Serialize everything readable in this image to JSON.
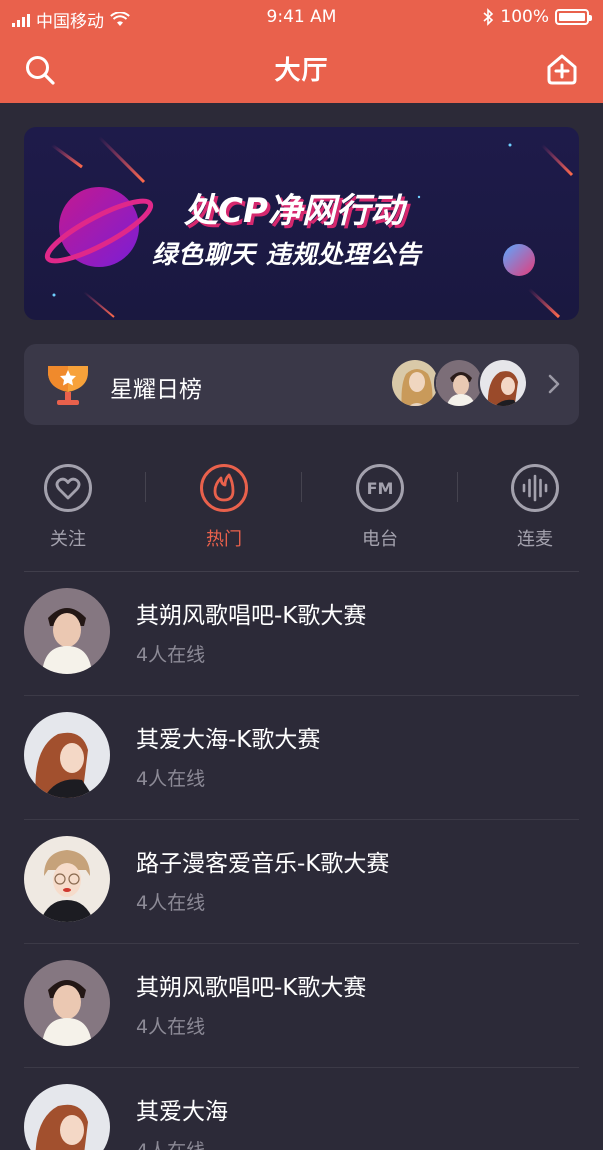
{
  "status_bar": {
    "carrier": "中国移动",
    "time": "9:41 AM",
    "battery": "100%"
  },
  "nav": {
    "title": "大厅",
    "left_icon": "search-icon",
    "right_icon": "add-room-icon"
  },
  "banner": {
    "title": "处CP净网行动",
    "subtitle": "绿色聊天 违规处理公告"
  },
  "rank": {
    "label": "星耀日榜",
    "icon": "trophy-icon"
  },
  "categories": [
    {
      "label": "关注",
      "icon": "heart-icon",
      "active": false
    },
    {
      "label": "热门",
      "icon": "fire-icon",
      "active": true
    },
    {
      "label": "电台",
      "icon": "fm-icon",
      "active": false
    },
    {
      "label": "连麦",
      "icon": "voice-wave-icon",
      "active": false
    }
  ],
  "rooms": [
    {
      "name": "其朔风歌唱吧-K歌大赛",
      "online": "4人在线"
    },
    {
      "name": "其爱大海-K歌大赛",
      "online": "4人在线"
    },
    {
      "name": "路子漫客爱音乐-K歌大赛",
      "online": "4人在线"
    },
    {
      "name": "其朔风歌唱吧-K歌大赛",
      "online": "4人在线"
    },
    {
      "name": "其爱大海",
      "online": "4人在线"
    }
  ],
  "colors": {
    "accent": "#e9614c",
    "background": "#2c2a38",
    "card": "#3a3848"
  }
}
